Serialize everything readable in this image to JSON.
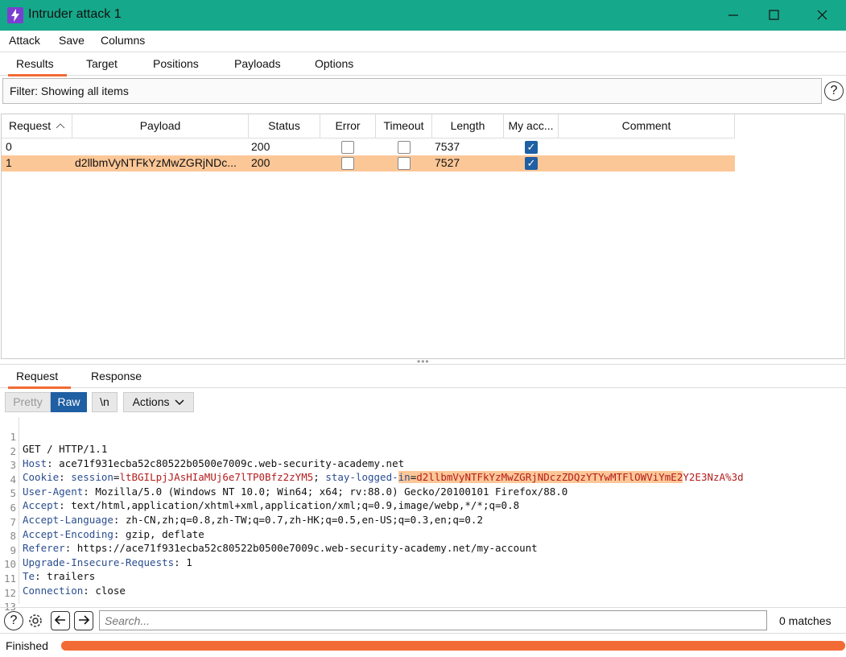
{
  "window": {
    "title": "Intruder attack 1"
  },
  "menu": {
    "items": [
      "Attack",
      "Save",
      "Columns"
    ]
  },
  "top_tabs": {
    "items": [
      "Results",
      "Target",
      "Positions",
      "Payloads",
      "Options"
    ],
    "active": "Results"
  },
  "filter": {
    "text": "Filter: Showing all items"
  },
  "results_table": {
    "headers": [
      "Request",
      "Payload",
      "Status",
      "Error",
      "Timeout",
      "Length",
      "My acc...",
      "Comment"
    ],
    "sort_column": "Request",
    "rows": [
      {
        "request": "0",
        "payload": "",
        "status": "200",
        "error": false,
        "timeout": false,
        "length": "7537",
        "my_account": true,
        "comment": "",
        "selected": false
      },
      {
        "request": "1",
        "payload": "d2llbmVyNTFkYzMwZGRjNDc...",
        "status": "200",
        "error": false,
        "timeout": false,
        "length": "7527",
        "my_account": true,
        "comment": "",
        "selected": true
      }
    ]
  },
  "bottom_tabs": {
    "items": [
      "Request",
      "Response"
    ],
    "active": "Request"
  },
  "editor_toolbar": {
    "pretty": "Pretty",
    "raw": "Raw",
    "newline": "\\n",
    "actions": "Actions",
    "active": "Raw"
  },
  "request_lines": [
    {
      "n": "1",
      "key": "",
      "sep": "",
      "value": "GET / HTTP/1.1"
    },
    {
      "n": "2",
      "key": "Host",
      "sep": ": ",
      "value": "ace71f931ecba52c80522b0500e7009c.web-security-academy.net"
    },
    {
      "n": "3",
      "key": "Cookie",
      "sep": ": ",
      "cookie": {
        "k1": "session",
        "v1": "ltBGILpjJAsHIaMUj6e7lTP0Bfz2zYM5",
        "k2": "stay-logged-",
        "k2hl": "in",
        "v2hl": "d2llbmVyNTFkYzMwZGRjNDczZDQzYTYwMTFlOWViYmE2",
        "v2rest": "Y2E3NzA%3d"
      }
    },
    {
      "n": "4",
      "key": "User-Agent",
      "sep": ": ",
      "value": "Mozilla/5.0 (Windows NT 10.0; Win64; x64; rv:88.0) Gecko/20100101 Firefox/88.0"
    },
    {
      "n": "5",
      "key": "Accept",
      "sep": ": ",
      "value": "text/html,application/xhtml+xml,application/xml;q=0.9,image/webp,*/*;q=0.8"
    },
    {
      "n": "6",
      "key": "Accept-Language",
      "sep": ": ",
      "value": "zh-CN,zh;q=0.8,zh-TW;q=0.7,zh-HK;q=0.5,en-US;q=0.3,en;q=0.2"
    },
    {
      "n": "7",
      "key": "Accept-Encoding",
      "sep": ": ",
      "value": "gzip, deflate"
    },
    {
      "n": "8",
      "key": "Referer",
      "sep": ": ",
      "value": "https://ace71f931ecba52c80522b0500e7009c.web-security-academy.net/my-account"
    },
    {
      "n": "9",
      "key": "Upgrade-Insecure-Requests",
      "sep": ": ",
      "value": "1"
    },
    {
      "n": "10",
      "key": "Te",
      "sep": ": ",
      "value": "trailers"
    },
    {
      "n": "11",
      "key": "Connection",
      "sep": ": ",
      "value": "close"
    },
    {
      "n": "12",
      "key": "",
      "sep": "",
      "value": ""
    },
    {
      "n": "13",
      "key": "",
      "sep": "",
      "value": ""
    }
  ],
  "search": {
    "placeholder": "Search...",
    "matches": "0 matches"
  },
  "status_bar": {
    "text": "Finished",
    "progress": 1.0
  },
  "colors": {
    "titlebar": "#16a88a",
    "accent": "#f26b35",
    "selected_row": "#fcc797",
    "raw_active": "#1f5fa3"
  }
}
